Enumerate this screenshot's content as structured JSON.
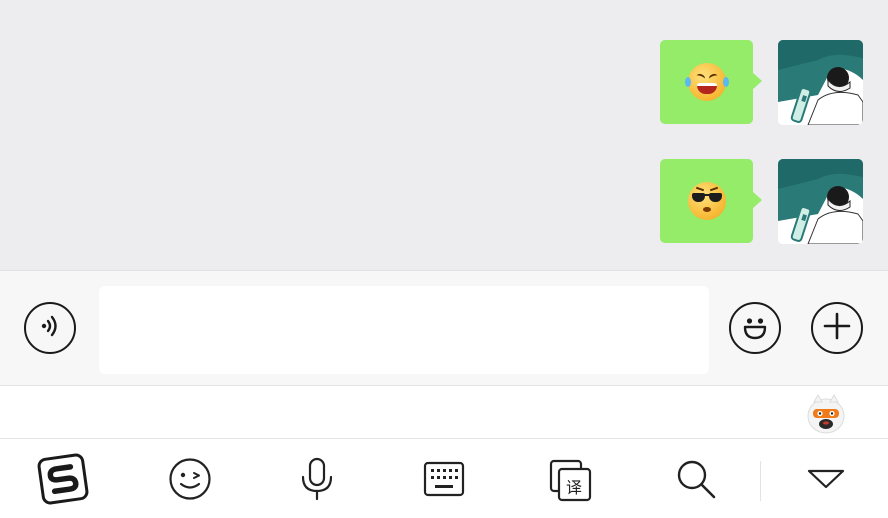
{
  "chat": {
    "messages": [
      {
        "sender": "self",
        "type": "emoji",
        "emoji": "laughing-tears-emoji"
      },
      {
        "sender": "self",
        "type": "emoji",
        "emoji": "cool-sunglasses-emoji"
      }
    ],
    "bubble_color": "#95ec69",
    "background": "#ededf0"
  },
  "input_bar": {
    "text_value": "",
    "voice_icon": "voice-wave-icon",
    "emoji_icon": "smiley-icon",
    "more_icon": "plus-icon"
  },
  "candidate_strip": {
    "mascot_icon": "ime-mascot-icon"
  },
  "keyboard_toolbar": {
    "items": [
      {
        "name": "sogou-logo-icon"
      },
      {
        "name": "emoji-face-icon"
      },
      {
        "name": "microphone-icon"
      },
      {
        "name": "keyboard-icon"
      },
      {
        "name": "translate-icon",
        "glyph": "译"
      },
      {
        "name": "search-icon"
      },
      {
        "name": "hide-keyboard-icon"
      }
    ]
  }
}
